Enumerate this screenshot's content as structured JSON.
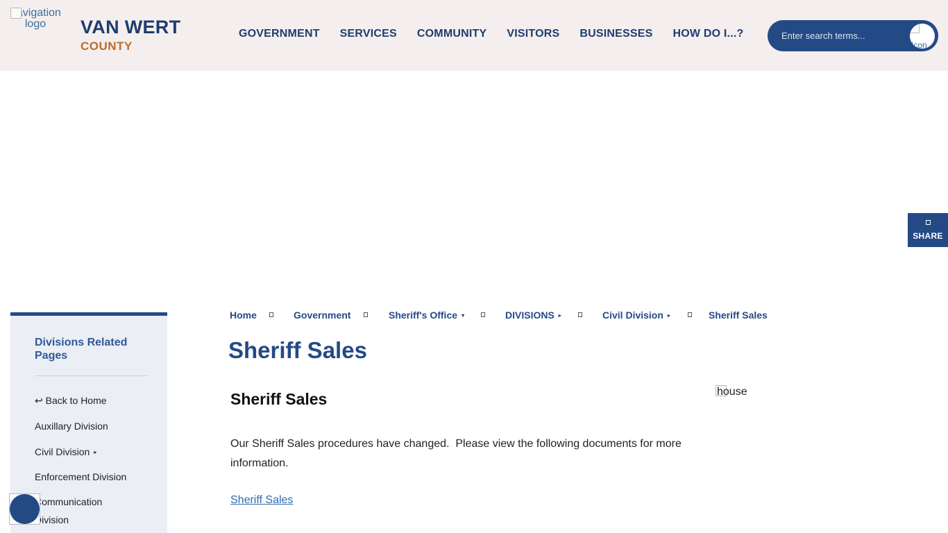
{
  "header": {
    "logo_alt": "navigation logo",
    "site_title": "VAN WERT",
    "site_subtitle": "COUNTY",
    "nav": [
      "GOVERNMENT",
      "SERVICES",
      "COMMUNITY",
      "VISITORS",
      "BUSINESSES",
      "HOW DO I...?"
    ],
    "search": {
      "placeholder": "Enter search terms...",
      "button_alt": "Icon"
    }
  },
  "share": {
    "label": "SHARE"
  },
  "sidebar": {
    "title": "Divisions Related Pages",
    "items": [
      {
        "label": "↩ Back to Home"
      },
      {
        "label": "Auxillary Division"
      },
      {
        "label": "Civil Division",
        "has_arrow": true
      },
      {
        "label": "Enforcement Division"
      },
      {
        "label": "Communication Division"
      }
    ]
  },
  "breadcrumb": [
    {
      "label": "Home"
    },
    {
      "label": "Government"
    },
    {
      "label": "Sheriff's Office",
      "caret": "▾"
    },
    {
      "label": "DIVISIONS",
      "caret": "▸"
    },
    {
      "label": "Civil Division",
      "caret": "▸"
    },
    {
      "label": "Sheriff Sales"
    }
  ],
  "main": {
    "page_title": "Sheriff Sales",
    "section_heading": "Sheriff Sales",
    "body": "Our Sheriff Sales procedures have changed.  Please view the following documents for more information.",
    "link": "Sheriff Sales",
    "image_alt": "house"
  },
  "colors": {
    "primary": "#244a86",
    "accent": "#c06a2b",
    "header_bg": "#f4efee",
    "sidebar_bg": "#ebeef5"
  }
}
